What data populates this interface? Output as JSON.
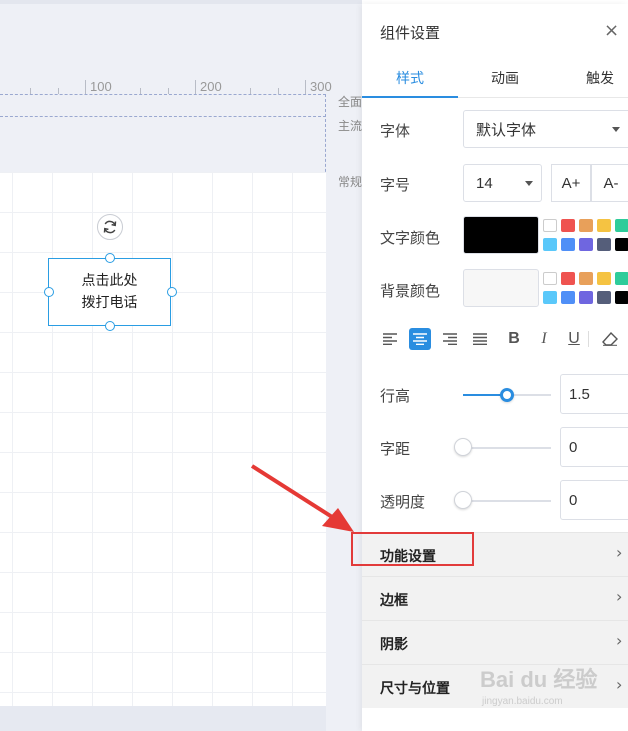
{
  "canvas": {
    "ruler_labels": [
      "100",
      "200",
      "300"
    ],
    "side_labels": [
      "全面",
      "主流",
      "常规"
    ],
    "element_text_line1": "点击此处",
    "element_text_line2": "拨打电话"
  },
  "panel": {
    "title": "组件设置",
    "close_icon": "×",
    "tabs": [
      {
        "label": "样式",
        "active": true
      },
      {
        "label": "动画",
        "active": false
      },
      {
        "label": "触发",
        "active": false
      }
    ],
    "font_label": "字体",
    "font_value": "默认字体",
    "size_label": "字号",
    "size_value": "14",
    "size_increase": "A+",
    "size_decrease": "A-",
    "text_color_label": "文字颜色",
    "text_color_value": "#000000",
    "bg_color_label": "背景颜色",
    "bg_color_value": "#f7f7f7",
    "swatches_row1": [
      "#ffffff",
      "#ef5350",
      "#e8a05a",
      "#f5c342",
      "#2ecc9a"
    ],
    "swatches_row2": [
      "#5ac8fa",
      "#4f8ff7",
      "#6f66e0",
      "#555e7a",
      "#000000"
    ],
    "toolbar_icons": [
      "align-left-icon",
      "align-center-icon",
      "align-right-icon",
      "align-justify-icon",
      "bold-icon",
      "italic-icon",
      "underline-icon",
      "eraser-icon"
    ],
    "bold_glyph": "B",
    "italic_glyph": "I",
    "underline_glyph": "U",
    "line_height_label": "行高",
    "line_height_value": "1.5",
    "line_height_fraction": 0.5,
    "letter_spacing_label": "字距",
    "letter_spacing_value": "0",
    "opacity_label": "透明度",
    "opacity_value": "0",
    "sections": [
      "功能设置",
      "边框",
      "阴影",
      "尺寸与位置"
    ],
    "chevron": "›"
  },
  "watermark": {
    "text": "Bai du 经验",
    "sub": "jingyan.baidu.com"
  },
  "colors": {
    "accent": "#2a8de0",
    "highlight": "#e23b3b",
    "arrow": "#e53935"
  }
}
